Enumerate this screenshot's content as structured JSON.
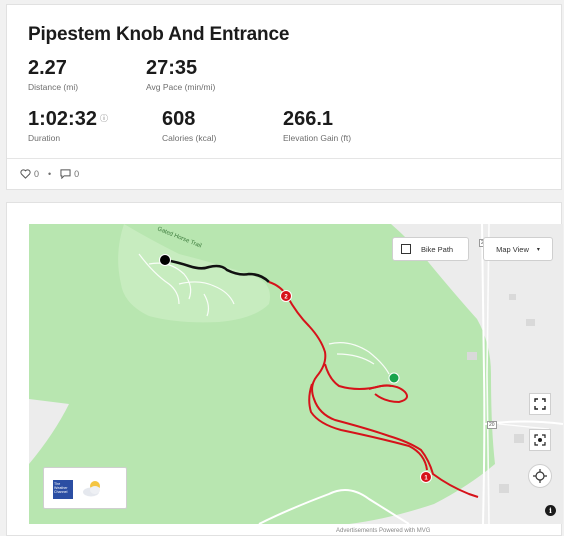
{
  "activity": {
    "title": "Pipestem Knob And Entrance",
    "stats": [
      {
        "value": "2.27",
        "label": "Distance (mi)"
      },
      {
        "value": "27:35",
        "label": "Avg Pace (min/mi)"
      },
      {
        "value": "1:02:32",
        "label": "Duration"
      },
      {
        "value": "608",
        "label": "Calories (kcal)"
      },
      {
        "value": "266.1",
        "label": "Elevation Gain (ft)"
      }
    ]
  },
  "social": {
    "likes": "0",
    "comments": "0"
  },
  "map": {
    "trail_label": "Gated Horse Trail",
    "bike_path_label": "Bike Path",
    "map_view_label": "Map View",
    "markers": [
      "1",
      "2"
    ],
    "road_labels": [
      "20",
      "20"
    ],
    "weather": {
      "brand": "The Weather Channel",
      "icon": "partly-cloudy-icon"
    },
    "colors": {
      "park": "#b8e6b0",
      "route": "#d6121a",
      "start": "#18a44b",
      "end": "#000000"
    }
  },
  "footnote": "Advertisements Powered with MVG"
}
